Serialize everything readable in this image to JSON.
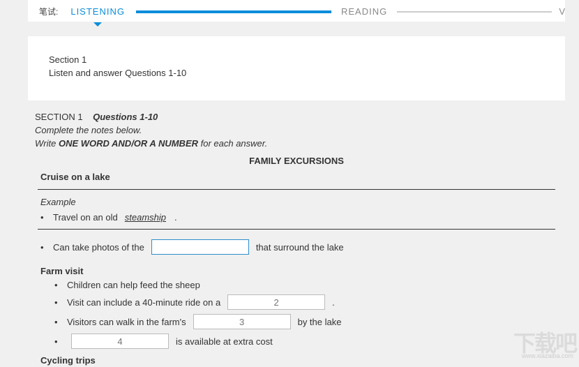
{
  "tabs": {
    "label": "笔试:",
    "listening": "LISTENING",
    "reading": "READING",
    "edge": "V"
  },
  "section_panel": {
    "title": "Section 1",
    "subtitle": "Listen and answer Questions 1-10"
  },
  "questions": {
    "header_section": "SECTION 1",
    "header_q": "Questions 1-10",
    "instr1": "Complete the notes below.",
    "instr2_pre": "Write ",
    "instr2_bold": "ONE WORD AND/OR A NUMBER",
    "instr2_post": " for each answer.",
    "title": "FAMILY EXCURSIONS",
    "cruise": "Cruise on a lake",
    "example_label": "Example",
    "example_row_pre": "Travel on an old",
    "example_answer": "steamship",
    "example_row_post": ".",
    "q1_pre": "Can take photos of the",
    "q1_post": "that surround the lake",
    "farm": "Farm visit",
    "farm_row1": "Children can help feed the sheep",
    "q2_pre": "Visit can include a 40-minute ride on a",
    "q2_ph": "2",
    "q2_post": ".",
    "q3_pre": "Visitors can walk in the farm's",
    "q3_ph": "3",
    "q3_post": "by the lake",
    "q4_ph": "4",
    "q4_post": "is available at extra cost",
    "cycling": "Cycling trips"
  },
  "watermark": {
    "main": "下载吧",
    "sub": "www.xiazaiba.com"
  }
}
